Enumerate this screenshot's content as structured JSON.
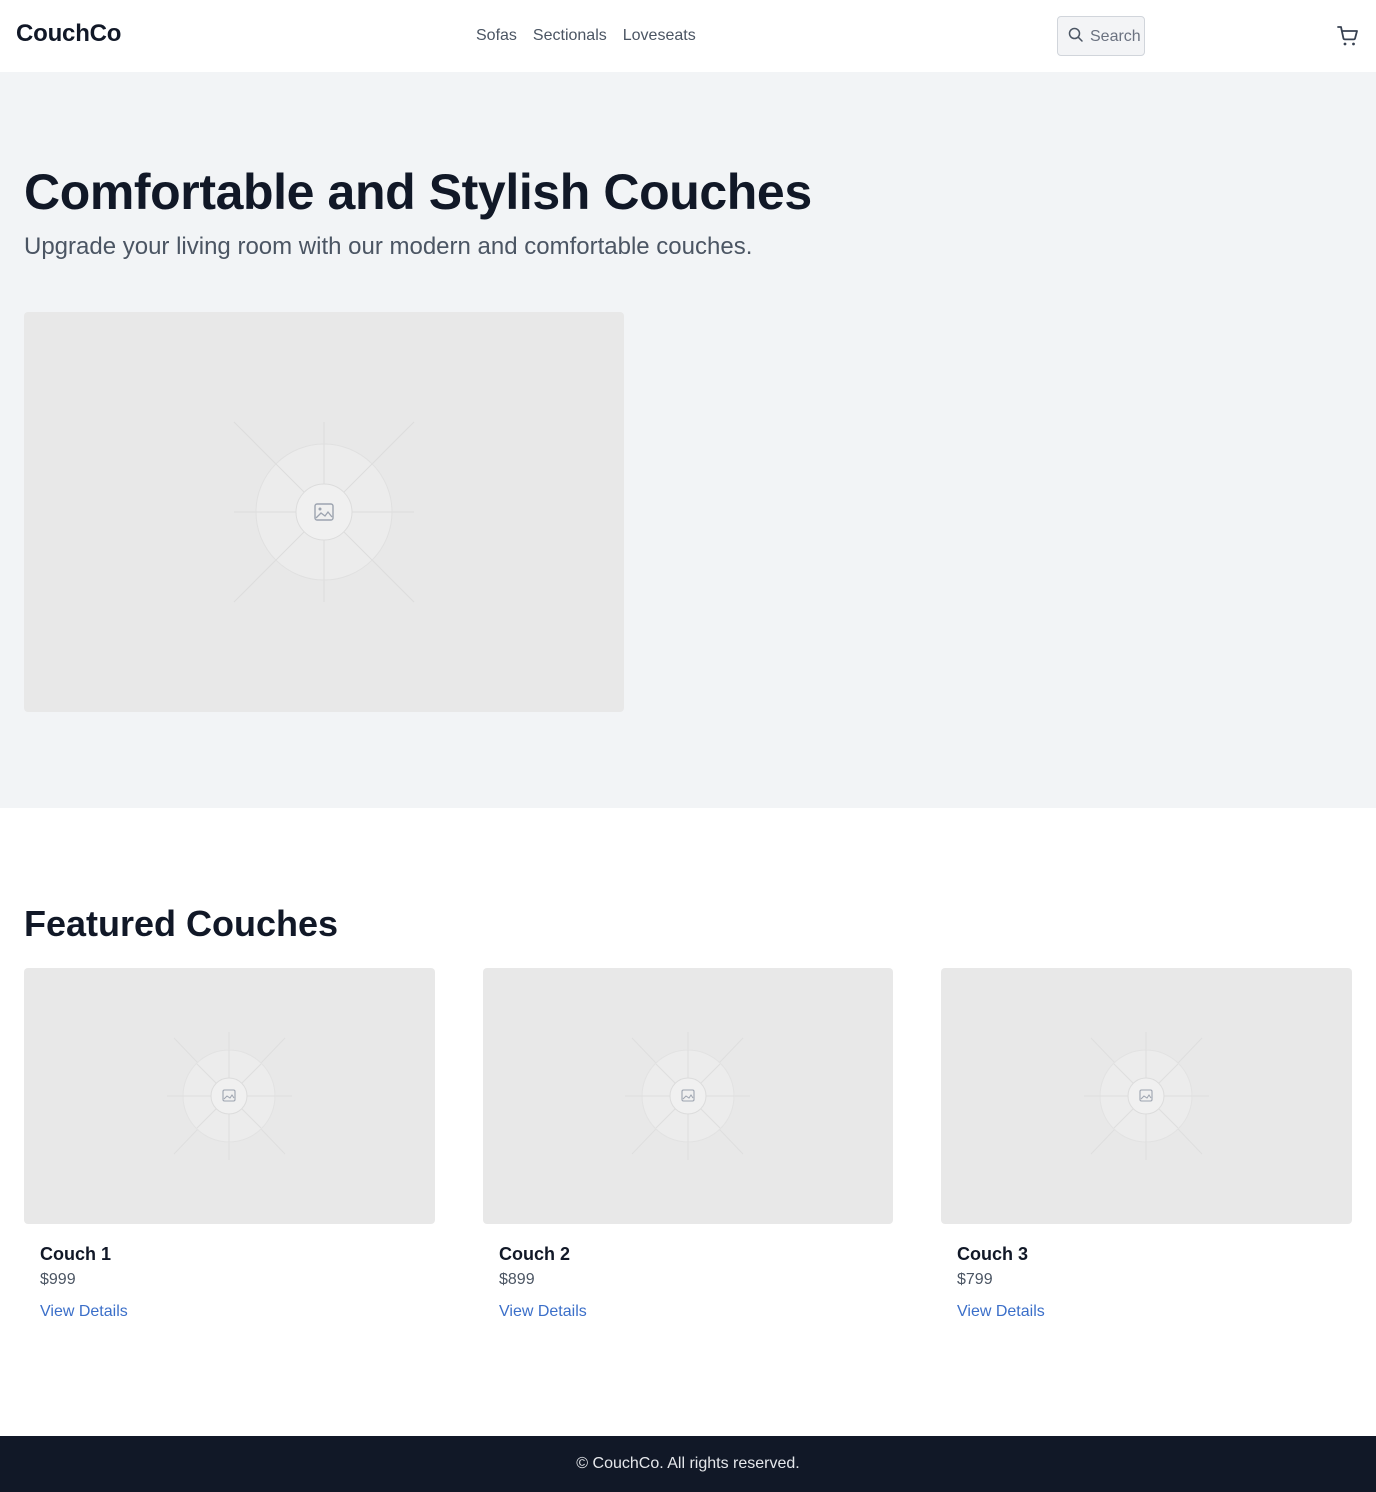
{
  "header": {
    "brand": "CouchCo",
    "nav": [
      "Sofas",
      "Sectionals",
      "Loveseats"
    ],
    "search_placeholder": "Search",
    "cart_icon": "shopping-cart-icon",
    "search_icon": "search-icon"
  },
  "hero": {
    "title": "Comfortable and Stylish Couches",
    "subtitle": "Upgrade your living room with our modern and comfortable couches.",
    "image_icon": "image-placeholder-icon"
  },
  "featured": {
    "title": "Featured Couches",
    "products": [
      {
        "name": "Couch 1",
        "price": "$999",
        "link": "View Details"
      },
      {
        "name": "Couch 2",
        "price": "$899",
        "link": "View Details"
      },
      {
        "name": "Couch 3",
        "price": "$799",
        "link": "View Details"
      }
    ]
  },
  "footer": {
    "text": "© CouchCo. All rights reserved."
  },
  "colors": {
    "primary_text": "#111827",
    "secondary_text": "#4b5563",
    "link": "#3b6fc9",
    "hero_bg": "#f2f4f6",
    "footer_bg": "#111827",
    "placeholder_bg": "#e8e8e8"
  }
}
